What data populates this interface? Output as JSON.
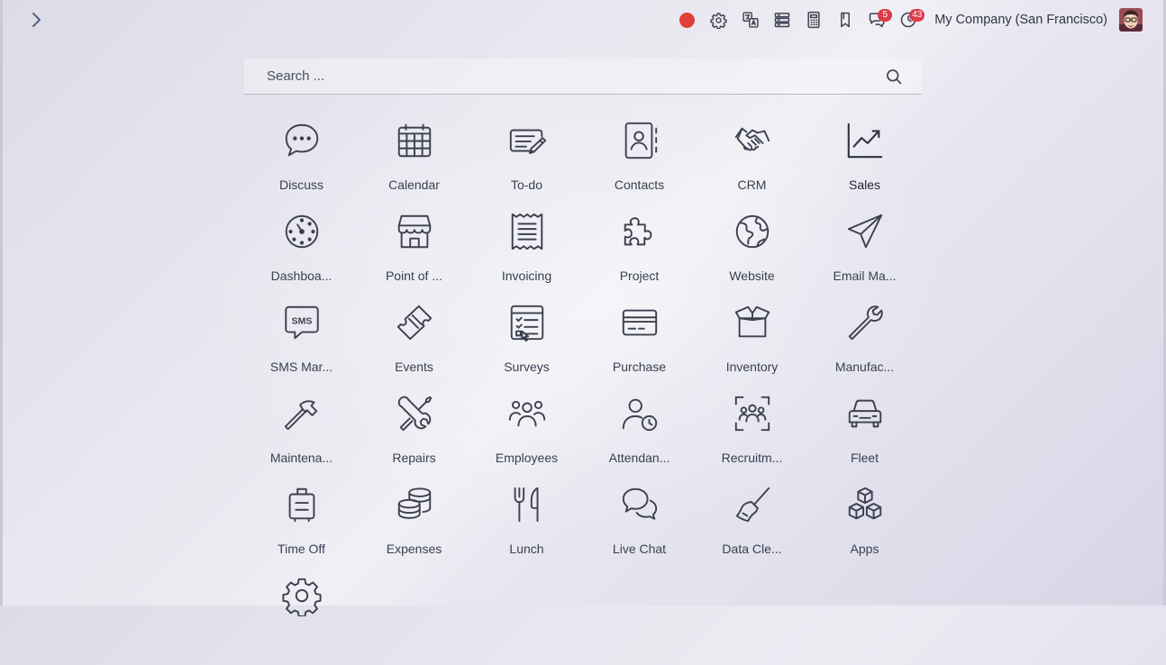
{
  "topbar": {
    "company": "My Company (San Francisco)",
    "tray": [
      {
        "name": "record-dot"
      },
      {
        "name": "settings-gear-icon"
      },
      {
        "name": "translate-icon"
      },
      {
        "name": "server-stack-icon"
      },
      {
        "name": "calculator-icon"
      },
      {
        "name": "bookmark-icon"
      },
      {
        "name": "messages-icon",
        "badge": "5"
      },
      {
        "name": "activity-clock-icon",
        "badge": "43"
      }
    ]
  },
  "search": {
    "placeholder": "Search ..."
  },
  "apps": [
    {
      "label": "Discuss",
      "icon": "chat-bubble-icon"
    },
    {
      "label": "Calendar",
      "icon": "calendar-icon"
    },
    {
      "label": "To-do",
      "icon": "todo-icon"
    },
    {
      "label": "Contacts",
      "icon": "contacts-book-icon"
    },
    {
      "label": "CRM",
      "icon": "handshake-icon"
    },
    {
      "label": "Sales",
      "icon": "sales-chart-icon"
    },
    {
      "label": "Dashboa...",
      "icon": "dashboard-gauge-icon"
    },
    {
      "label": "Point of ...",
      "icon": "shop-icon"
    },
    {
      "label": "Invoicing",
      "icon": "receipt-icon"
    },
    {
      "label": "Project",
      "icon": "puzzle-icon"
    },
    {
      "label": "Website",
      "icon": "globe-icon"
    },
    {
      "label": "Email Ma...",
      "icon": "paper-plane-icon"
    },
    {
      "label": "SMS Mar...",
      "icon": "sms-bubble-icon"
    },
    {
      "label": "Events",
      "icon": "ticket-icon"
    },
    {
      "label": "Surveys",
      "icon": "survey-checklist-icon"
    },
    {
      "label": "Purchase",
      "icon": "credit-card-icon"
    },
    {
      "label": "Inventory",
      "icon": "open-box-icon"
    },
    {
      "label": "Manufac...",
      "icon": "wrench-icon"
    },
    {
      "label": "Maintena...",
      "icon": "hammer-icon"
    },
    {
      "label": "Repairs",
      "icon": "tools-icon"
    },
    {
      "label": "Employees",
      "icon": "people-group-icon"
    },
    {
      "label": "Attendan...",
      "icon": "person-clock-icon"
    },
    {
      "label": "Recruitm...",
      "icon": "recruitment-frame-icon"
    },
    {
      "label": "Fleet",
      "icon": "car-icon"
    },
    {
      "label": "Time Off",
      "icon": "suitcase-icon"
    },
    {
      "label": "Expenses",
      "icon": "coins-icon"
    },
    {
      "label": "Lunch",
      "icon": "fork-knife-icon"
    },
    {
      "label": "Live Chat",
      "icon": "chat-bubbles-icon"
    },
    {
      "label": "Data Cle...",
      "icon": "broom-icon"
    },
    {
      "label": "Apps",
      "icon": "cubes-icon"
    },
    {
      "label": "",
      "icon": "settings-icon"
    }
  ]
}
